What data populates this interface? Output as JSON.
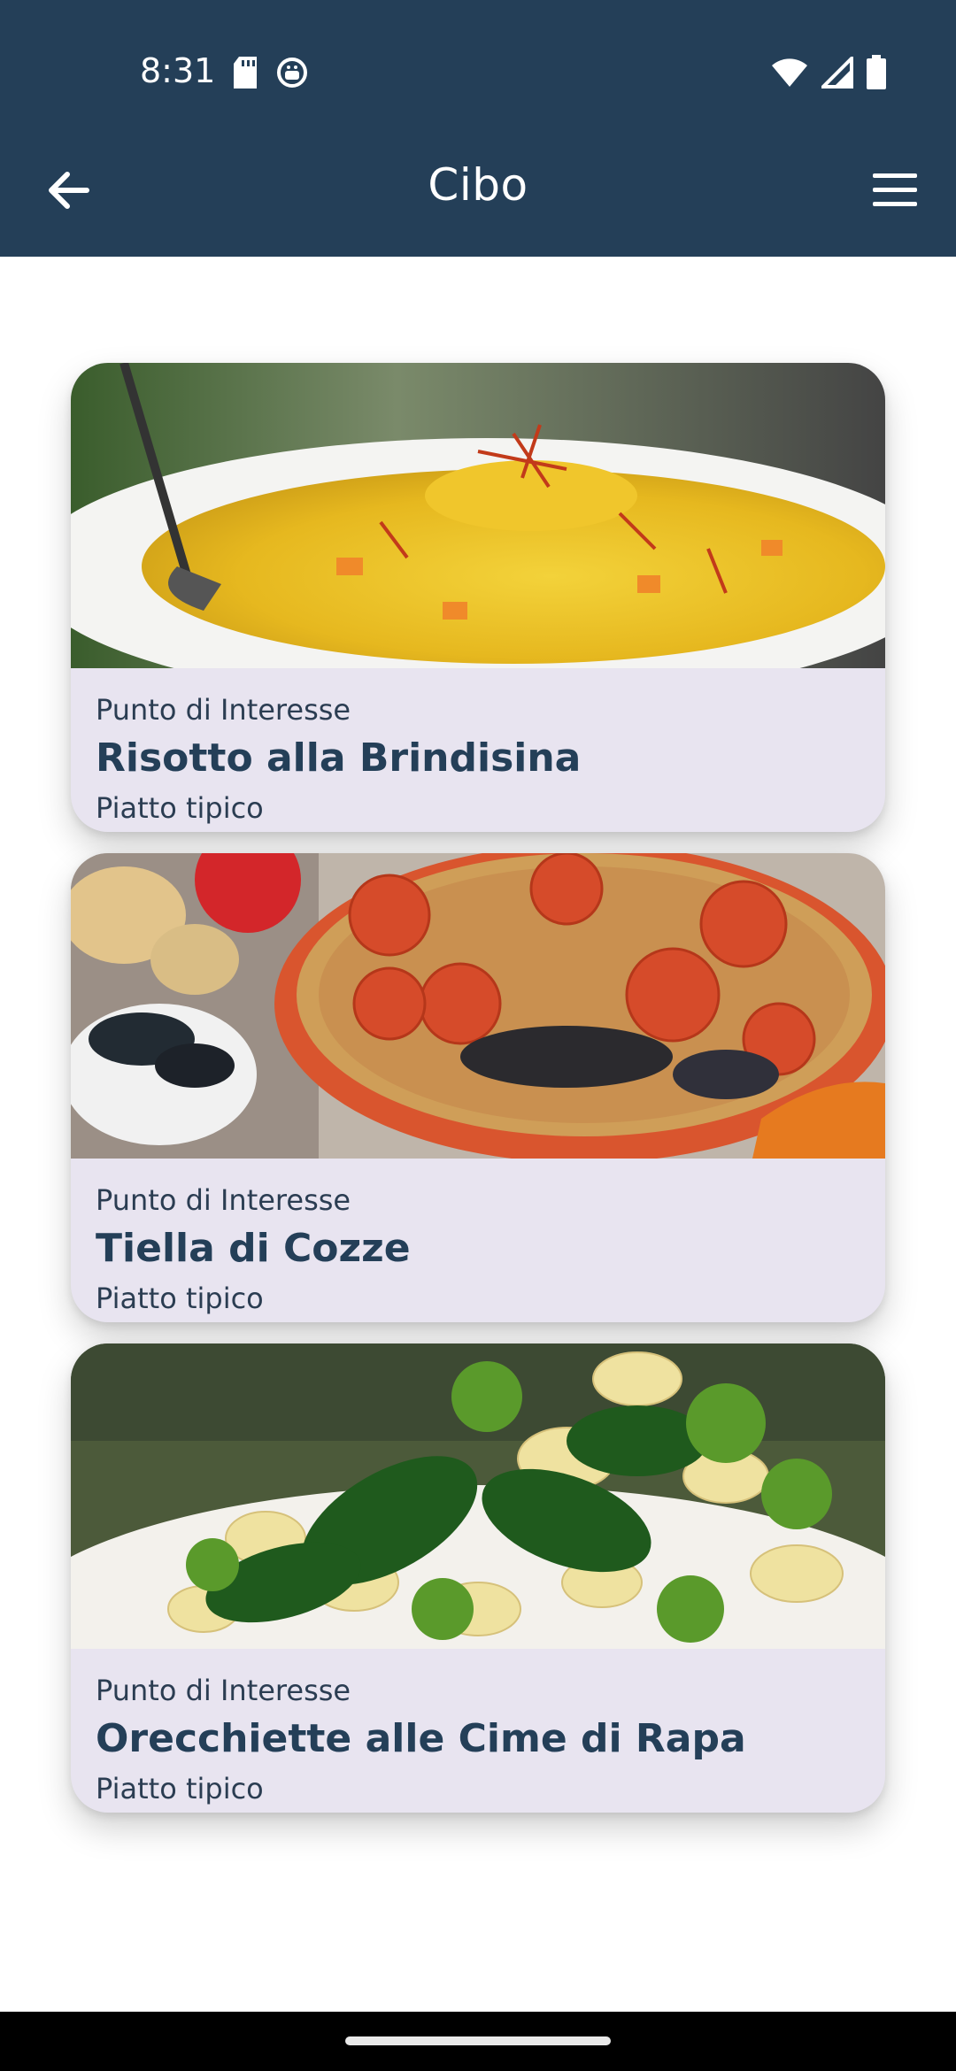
{
  "status_bar": {
    "time": "8:31",
    "icons": [
      "sd-card-icon",
      "android-notification-icon",
      "wifi-icon",
      "signal-icon",
      "battery-icon"
    ]
  },
  "toolbar": {
    "title": "Cibo",
    "back_icon": "arrow-left-icon",
    "menu_icon": "hamburger-menu-icon"
  },
  "colors": {
    "app_bar": "#243f58",
    "card_bg": "#e8e4f0",
    "title_text": "#243f58"
  },
  "cards": [
    {
      "kicker": "Punto di Interesse",
      "title": "Risotto alla Brindisina",
      "subtitle": "Piatto tipico",
      "image": "risotto-photo"
    },
    {
      "kicker": "Punto di Interesse",
      "title": "Tiella di Cozze",
      "subtitle": "Piatto tipico",
      "image": "tiella-photo"
    },
    {
      "kicker": "Punto di Interesse",
      "title": "Orecchiette alle Cime di Rapa",
      "subtitle": "Piatto tipico",
      "image": "orecchiette-photo"
    }
  ]
}
